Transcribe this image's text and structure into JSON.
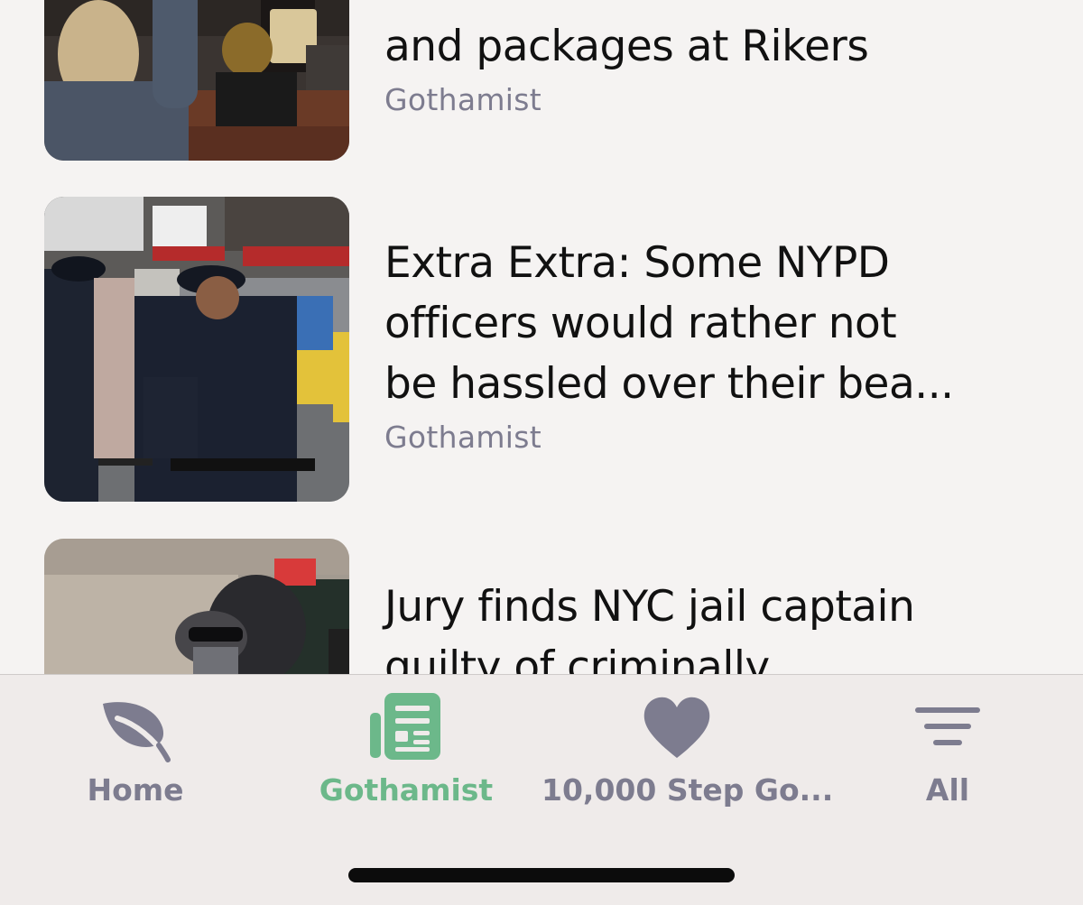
{
  "articles": [
    {
      "title": "and packages at Rikers",
      "source": "Gothamist",
      "image": "theater-audience-photo"
    },
    {
      "title": "Extra Extra: Some NYPD\nofficers would rather not\nbe hassled over their bea...",
      "source": "Gothamist",
      "image": "nypd-officers-rally-photo"
    },
    {
      "title": "Jury finds NYC jail captain\nguilty of criminally",
      "source": "",
      "image": "masked-person-photo"
    }
  ],
  "tabbar": {
    "tabs": [
      {
        "label": "Home",
        "icon": "leaf-icon",
        "active": false
      },
      {
        "label": "Gothamist",
        "icon": "newspaper-icon",
        "active": true
      },
      {
        "label": "10,000 Step Go...",
        "icon": "heart-icon",
        "active": false
      },
      {
        "label": "All",
        "icon": "menu-lines-icon",
        "active": false
      }
    ],
    "active_color": "#6cb88a",
    "inactive_color": "#7d7c8f"
  }
}
